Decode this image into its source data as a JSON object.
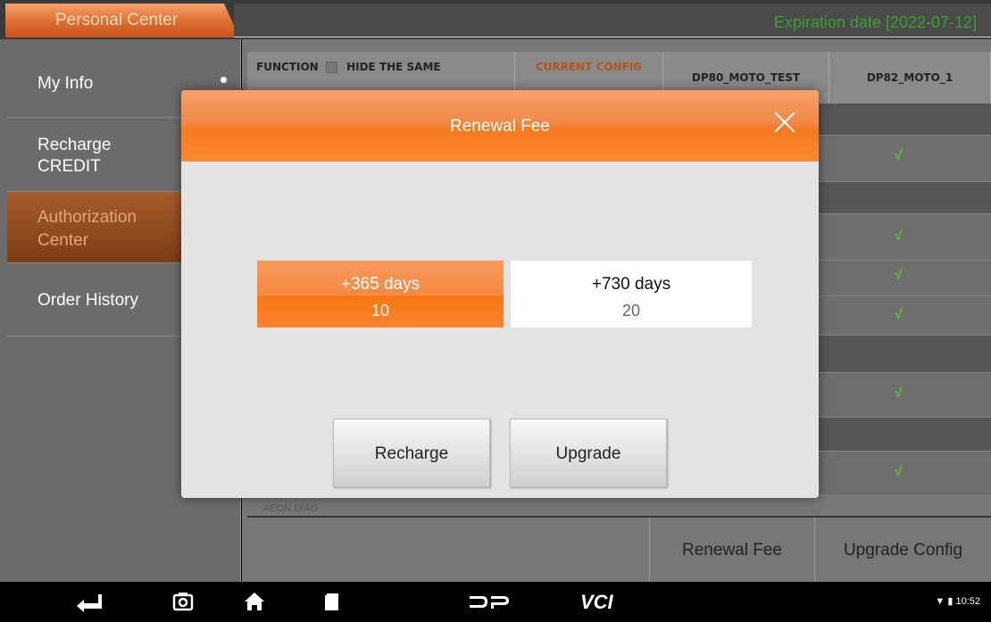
{
  "top_bar": {
    "tab_label": "Personal Center",
    "expiration": "Expiration date [2022-07-12]"
  },
  "sidebar": {
    "items": [
      {
        "label": "My Info",
        "active": false
      },
      {
        "label": "Recharge CREDIT",
        "active": false
      },
      {
        "label": "Authorization Center",
        "active": true
      },
      {
        "label": "Order History",
        "active": false
      }
    ]
  },
  "table": {
    "headers": {
      "function": "FUNCTION",
      "hide_same": "HIDE THE SAME",
      "current_config": "CURRENT CONFIG",
      "col1": "DP80_MOTO_TEST",
      "col2": "DP82_MOTO_1"
    },
    "check_symbol": "√",
    "partial_row_label": "AEON DIAG"
  },
  "bottom_buttons": {
    "renewal_fee": "Renewal Fee",
    "upgrade_config": "Upgrade Config"
  },
  "modal": {
    "title": "Renewal Fee",
    "options": [
      {
        "days": "+365 days",
        "price": "10",
        "selected": true
      },
      {
        "days": "+730 days",
        "price": "20",
        "selected": false
      }
    ],
    "recharge_label": "Recharge",
    "upgrade_label": "Upgrade"
  },
  "navbar": {
    "vci_label": "VCI",
    "time": "10:52"
  },
  "colors": {
    "accent_orange": "#f6791e",
    "expiration_green": "#3ba133",
    "check_green": "#63c23a"
  }
}
